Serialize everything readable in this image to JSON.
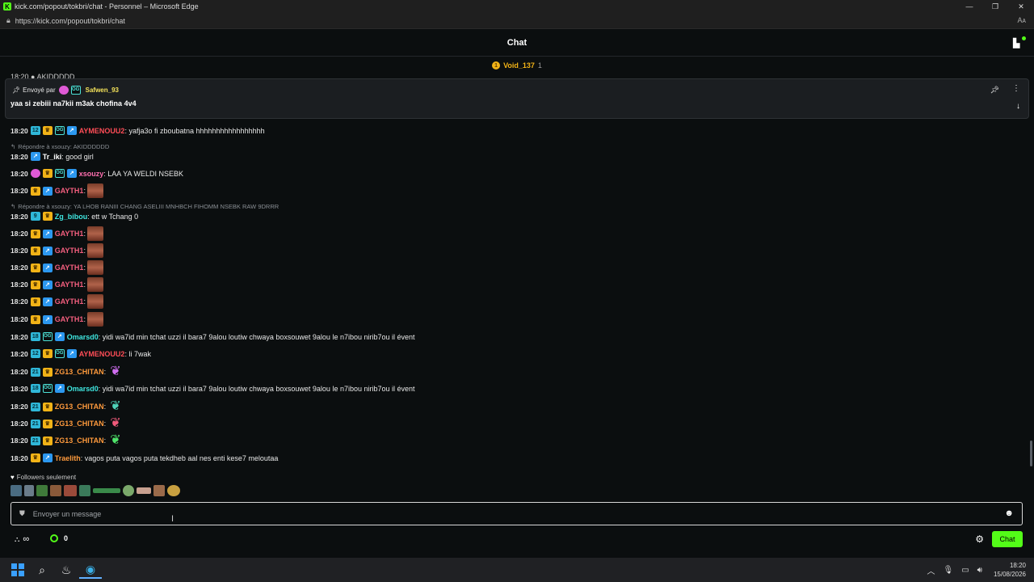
{
  "window": {
    "title": "kick.com/popout/tokbri/chat - Personnel – Microsoft Edge",
    "url": "https://kick.com/popout/tokbri/chat",
    "read_aloud": "Aᴀ"
  },
  "header": {
    "title": "Chat",
    "gifter_name": "Void_137",
    "gifter_count": "1"
  },
  "peek_text": "18:20 ● AKIDDDDD",
  "pinned": {
    "prefix": "Envoyé par",
    "username": "Safwen_93",
    "message": "yaa si zebiii na7kii m3ak chofina 4v4"
  },
  "messages": [
    {
      "time": "18:20",
      "user": "AYMENOUU2",
      "text": ": yafja3o fi zboubatna hhhhhhhhhhhhhhhhh"
    },
    {
      "reply": "Répondre à xsouzy: AKIDDDDDD"
    },
    {
      "time": "18:20",
      "user": "Tr_iki",
      "text": ": good girl"
    },
    {
      "time": "18:20",
      "user": "xsouzy",
      "text": ": LAA YA WELDI NSEBK"
    },
    {
      "time": "18:20",
      "user": "GAYTH1",
      "text": ":"
    },
    {
      "reply": "Répondre à xsouzy: YA LHOB RANIII CHANG ASELIII MNHBCH FIHOMM NSEBK RAW 9DRRR"
    },
    {
      "time": "18:20",
      "user": "Zg_bibou",
      "text": ": ett w Tchang 0"
    },
    {
      "time": "18:20",
      "user": "GAYTH1",
      "text": ":"
    },
    {
      "time": "18:20",
      "user": "GAYTH1",
      "text": ":"
    },
    {
      "time": "18:20",
      "user": "GAYTH1",
      "text": ":"
    },
    {
      "time": "18:20",
      "user": "GAYTH1",
      "text": ":"
    },
    {
      "time": "18:20",
      "user": "GAYTH1",
      "text": ":"
    },
    {
      "time": "18:20",
      "user": "GAYTH1",
      "text": ":"
    },
    {
      "time": "18:20",
      "user": "Omarsd0",
      "text": ": yidi wa7id min tchat uzzi il bara7 9alou loutiw chwaya boxsouwet 9alou le n7ibou nirib7ou il évent"
    },
    {
      "time": "18:20",
      "user": "AYMENOUU2",
      "text": ": li 7wak"
    },
    {
      "time": "18:20",
      "user": "ZG13_CHITAN",
      "text": ":"
    },
    {
      "time": "18:20",
      "user": "Omarsd0",
      "text": ": yidi wa7id min tchat uzzi il bara7 9alou loutiw chwaya boxsouwet 9alou le n7ibou nirib7ou il évent"
    },
    {
      "time": "18:20",
      "user": "ZG13_CHITAN",
      "text": ":"
    },
    {
      "time": "18:20",
      "user": "ZG13_CHITAN",
      "text": ":"
    },
    {
      "time": "18:20",
      "user": "ZG13_CHITAN",
      "text": ":"
    },
    {
      "time": "18:20",
      "user": "Traelith",
      "text": ": vagos puta vagos puta tekdheb aal nes enti kese7 meloutaa"
    }
  ],
  "badges": {
    "sub_a": "12",
    "sub_b": "9",
    "sub_c": "21",
    "sub_d": "18",
    "sub_e": "30",
    "sub_f": "6",
    "og": "OG"
  },
  "footer": {
    "followers_only": "Followers seulement",
    "input_placeholder": "Envoyer un message",
    "infinity": "∞",
    "points": "0",
    "chat_button": "Chat"
  },
  "taskbar": {
    "time": "18:20",
    "date": "15/08/2026"
  },
  "colors": {
    "accent": "#53fc18",
    "background": "#0b0e0f"
  }
}
